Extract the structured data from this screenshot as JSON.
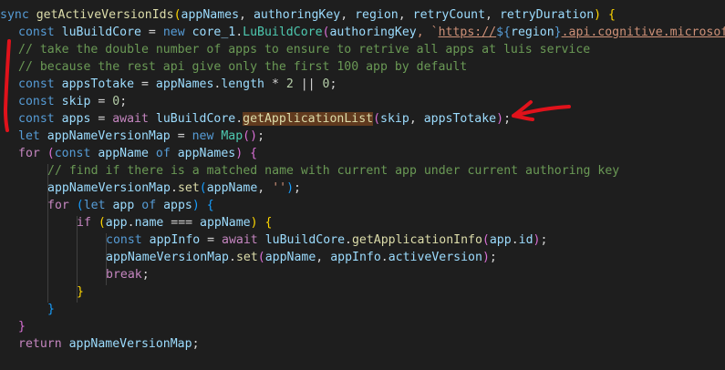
{
  "editor": {
    "lines": [
      [
        [
          "sync ",
          "kw"
        ],
        [
          "getActiveVersionIds",
          "fn"
        ],
        [
          "(",
          "br1"
        ],
        [
          "appNames",
          "var"
        ],
        [
          ", ",
          "pun"
        ],
        [
          "authoringKey",
          "var"
        ],
        [
          ", ",
          "pun"
        ],
        [
          "region",
          "var"
        ],
        [
          ", ",
          "pun"
        ],
        [
          "retryCount",
          "var"
        ],
        [
          ", ",
          "pun"
        ],
        [
          "retryDuration",
          "var"
        ],
        [
          ") ",
          "br1"
        ],
        [
          "{",
          "br1"
        ]
      ],
      [
        [
          "const ",
          "kw"
        ],
        [
          "luBuildCore",
          "var"
        ],
        [
          " = ",
          "pun"
        ],
        [
          "new ",
          "kw"
        ],
        [
          "core_1",
          "var"
        ],
        [
          ".",
          "pun"
        ],
        [
          "LuBuildCore",
          "cls"
        ],
        [
          "(",
          "br2"
        ],
        [
          "authoringKey",
          "var"
        ],
        [
          ", `",
          "str"
        ],
        [
          "https://",
          "url"
        ],
        [
          "${",
          "kw"
        ],
        [
          "region",
          "var"
        ],
        [
          "}",
          "kw"
        ],
        [
          ".api.cognitive.microsoft.c",
          "url"
        ]
      ],
      [
        [
          "// take the double number of apps to ensure to retrive all apps at luis service",
          "cmt"
        ]
      ],
      [
        [
          "// because the rest api give only the first 100 app by default",
          "cmt"
        ]
      ],
      [
        [
          "const ",
          "kw"
        ],
        [
          "appsTotake",
          "var"
        ],
        [
          " = ",
          "pun"
        ],
        [
          "appNames",
          "var"
        ],
        [
          ".",
          "pun"
        ],
        [
          "length",
          "var"
        ],
        [
          " * ",
          "pun"
        ],
        [
          "2",
          "num"
        ],
        [
          " || ",
          "pun"
        ],
        [
          "0",
          "num"
        ],
        [
          ";",
          "pun"
        ]
      ],
      [
        [
          "const ",
          "kw"
        ],
        [
          "skip",
          "var"
        ],
        [
          " = ",
          "pun"
        ],
        [
          "0",
          "num"
        ],
        [
          ";",
          "pun"
        ]
      ],
      [
        [
          "const ",
          "kw"
        ],
        [
          "apps",
          "var"
        ],
        [
          " = ",
          "pun"
        ],
        [
          "await ",
          "ctrl"
        ],
        [
          "luBuildCore",
          "var"
        ],
        [
          ".",
          "pun"
        ],
        [
          "getApplicationList",
          "fn hl"
        ],
        [
          "(",
          "br2"
        ],
        [
          "skip",
          "var"
        ],
        [
          ", ",
          "pun"
        ],
        [
          "appsTotake",
          "var"
        ],
        [
          ")",
          "br2"
        ],
        [
          ";",
          "pun"
        ]
      ],
      [
        [
          "let ",
          "kw"
        ],
        [
          "appNameVersionMap",
          "var"
        ],
        [
          " = ",
          "pun"
        ],
        [
          "new ",
          "kw"
        ],
        [
          "Map",
          "cls"
        ],
        [
          "()",
          "br2"
        ],
        [
          ";",
          "pun"
        ]
      ],
      [
        [
          "for ",
          "ctrl"
        ],
        [
          "(",
          "br2"
        ],
        [
          "const ",
          "kw"
        ],
        [
          "appName",
          "var"
        ],
        [
          " of ",
          "kw"
        ],
        [
          "appNames",
          "var"
        ],
        [
          ") ",
          "br2"
        ],
        [
          "{",
          "br2"
        ]
      ],
      [
        [
          "// find if there is a matched name with current app under current authoring key",
          "cmt"
        ]
      ],
      [
        [
          "appNameVersionMap",
          "var"
        ],
        [
          ".",
          "pun"
        ],
        [
          "set",
          "fn"
        ],
        [
          "(",
          "br3"
        ],
        [
          "appName",
          "var"
        ],
        [
          ", ",
          "pun"
        ],
        [
          "''",
          "str"
        ],
        [
          ")",
          "br3"
        ],
        [
          ";",
          "pun"
        ]
      ],
      [
        [
          "for ",
          "ctrl"
        ],
        [
          "(",
          "br3"
        ],
        [
          "let ",
          "kw"
        ],
        [
          "app",
          "var"
        ],
        [
          " of ",
          "kw"
        ],
        [
          "apps",
          "var"
        ],
        [
          ") ",
          "br3"
        ],
        [
          "{",
          "br3"
        ]
      ],
      [
        [
          "if ",
          "ctrl"
        ],
        [
          "(",
          "br1"
        ],
        [
          "app",
          "var"
        ],
        [
          ".",
          "pun"
        ],
        [
          "name",
          "var"
        ],
        [
          " === ",
          "pun"
        ],
        [
          "appName",
          "var"
        ],
        [
          ") ",
          "br1"
        ],
        [
          "{",
          "br1"
        ]
      ],
      [
        [
          "const ",
          "kw"
        ],
        [
          "appInfo",
          "var"
        ],
        [
          " = ",
          "pun"
        ],
        [
          "await ",
          "ctrl"
        ],
        [
          "luBuildCore",
          "var"
        ],
        [
          ".",
          "pun"
        ],
        [
          "getApplicationInfo",
          "fn"
        ],
        [
          "(",
          "br2"
        ],
        [
          "app",
          "var"
        ],
        [
          ".",
          "pun"
        ],
        [
          "id",
          "var"
        ],
        [
          ")",
          "br2"
        ],
        [
          ";",
          "pun"
        ]
      ],
      [
        [
          "appNameVersionMap",
          "var"
        ],
        [
          ".",
          "pun"
        ],
        [
          "set",
          "fn"
        ],
        [
          "(",
          "br2"
        ],
        [
          "appName",
          "var"
        ],
        [
          ", ",
          "pun"
        ],
        [
          "appInfo",
          "var"
        ],
        [
          ".",
          "pun"
        ],
        [
          "activeVersion",
          "var"
        ],
        [
          ")",
          "br2"
        ],
        [
          ";",
          "pun"
        ]
      ],
      [
        [
          "break",
          "ctrl"
        ],
        [
          ";",
          "pun"
        ]
      ],
      [
        [
          "}",
          "br1"
        ]
      ],
      [
        [
          "}",
          "br3"
        ]
      ],
      [
        [
          "}",
          "br2"
        ]
      ],
      [
        [
          "return ",
          "ctrl"
        ],
        [
          "appNameVersionMap",
          "var"
        ],
        [
          ";",
          "pun"
        ]
      ]
    ]
  },
  "annotation": {
    "color": "#e0121b"
  }
}
